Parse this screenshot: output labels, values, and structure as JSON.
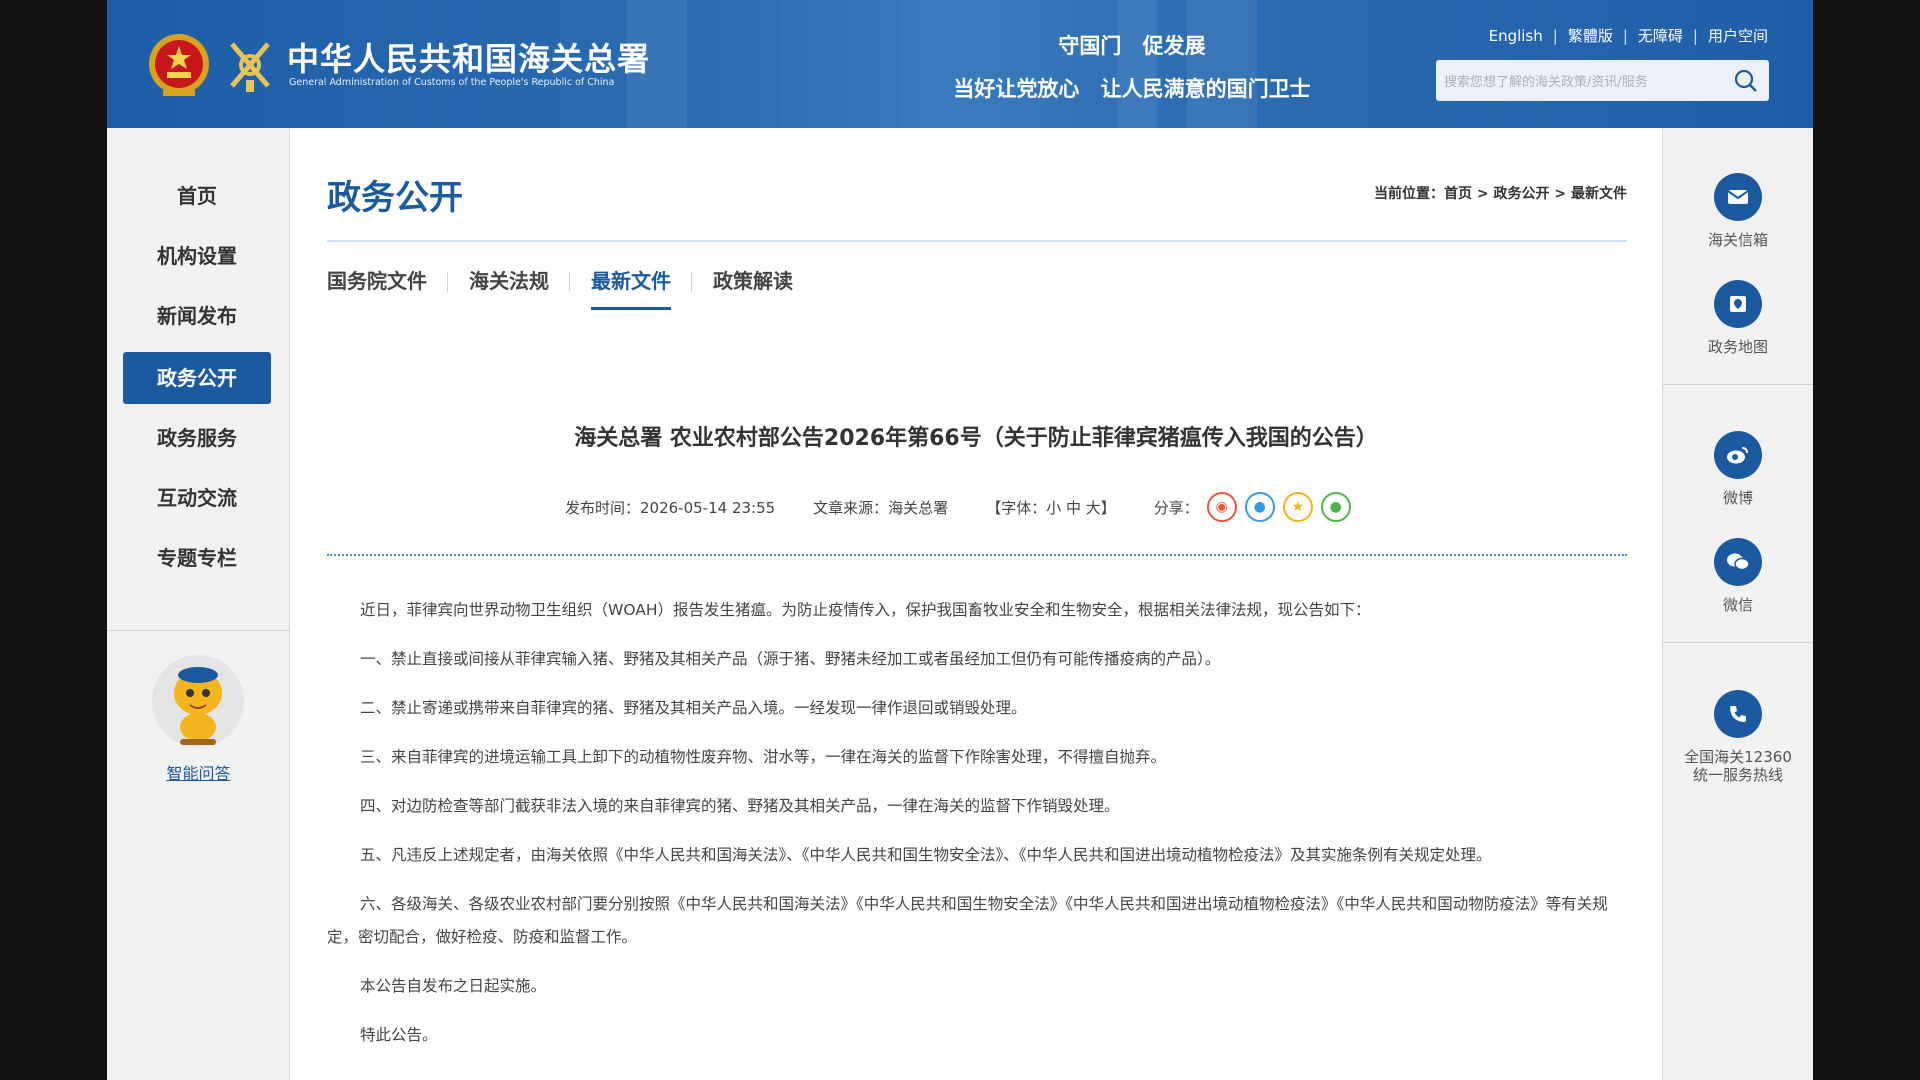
{
  "header": {
    "logo_cn": "中华人民共和国海关总署",
    "logo_en": "General Administration of Customs of the People's Republic of China",
    "slogan_line1": "守国门 促发展",
    "slogan_line2": "当好让党放心 让人民满意的国门卫士",
    "links": [
      "English",
      "繁體版",
      "无障碍",
      "用户空间"
    ],
    "search_placeholder": "搜索您想了解的海关政策/资讯/服务"
  },
  "left_nav": {
    "items": [
      "首页",
      "机构设置",
      "新闻发布",
      "政务公开",
      "政务服务",
      "互动交流",
      "专题专栏"
    ],
    "active_index": 3,
    "assistant_label": "智能问答"
  },
  "main": {
    "section_title": "政务公开",
    "breadcrumb": "当前位置：首页 > 政务公开 > 最新文件",
    "tabs": [
      "国务院文件",
      "海关法规",
      "最新文件",
      "政策解读"
    ],
    "active_tab": 2,
    "article": {
      "title": "海关总署 农业农村部公告2026年第66号（关于防止菲律宾猪瘟传入我国的公告）",
      "publish_time": "发布时间：2026-05-14 23:55",
      "source": "文章来源：海关总署",
      "font_size_label": "【字体：小 中 大】",
      "share_label": "分享：",
      "paragraphs": [
        "近日，菲律宾向世界动物卫生组织（WOAH）报告发生猪瘟。为防止疫情传入，保护我国畜牧业安全和生物安全，根据相关法律法规，现公告如下：",
        "一、禁止直接或间接从菲律宾输入猪、野猪及其相关产品（源于猪、野猪未经加工或者虽经加工但仍有可能传播疫病的产品）。",
        "二、禁止寄递或携带来自菲律宾的猪、野猪及其相关产品入境。一经发现一律作退回或销毁处理。",
        "三、来自菲律宾的进境运输工具上卸下的动植物性废弃物、泔水等，一律在海关的监督下作除害处理，不得擅自抛弃。",
        "四、对边防检查等部门截获非法入境的来自菲律宾的猪、野猪及其相关产品，一律在海关的监督下作销毁处理。",
        "五、凡违反上述规定者，由海关依照《中华人民共和国海关法》、《中华人民共和国生物安全法》、《中华人民共和国进出境动植物检疫法》及其实施条例有关规定处理。",
        "六、各级海关、各级农业农村部门要分别按照《中华人民共和国海关法》《中华人民共和国生物安全法》《中华人民共和国进出境动植物检疫法》《中华人民共和国动物防疫法》等有关规定，密切配合，做好检疫、防疫和监督工作。",
        "本公告自发布之日起实施。",
        "特此公告。"
      ]
    }
  },
  "right_bar": {
    "items": [
      {
        "label": "海关信箱",
        "icon": "mail-icon"
      },
      {
        "label": "政务地图",
        "icon": "map-icon"
      },
      {
        "label": "微博",
        "icon": "weibo-icon"
      },
      {
        "label": "微信",
        "icon": "wechat-icon"
      },
      {
        "label": "全国海关12360统一服务热线",
        "icon": "phone-icon"
      }
    ]
  },
  "colors": {
    "brand_blue": "#1c5aa0",
    "header_blue": "#2b6cb2",
    "share_weibo": "#e8563a",
    "share_qq": "#3a9ae0",
    "share_qzone": "#f2b31c",
    "share_wechat": "#4cb748"
  }
}
